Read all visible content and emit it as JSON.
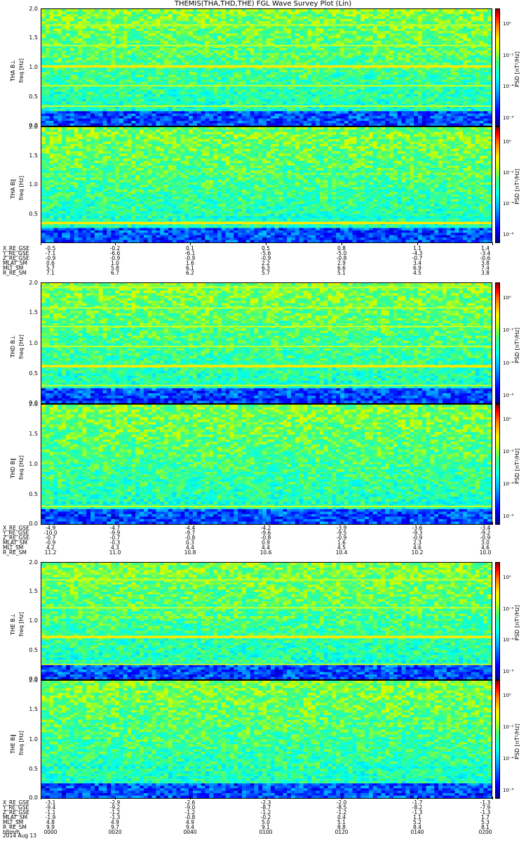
{
  "title": "THEMIS(THA,THD,THE) FGL Wave Survey Plot (Lin)",
  "colorbar": {
    "label": "PSD [nT²/Hz]",
    "ticks": [
      "10⁰",
      "10⁻²",
      "10⁻⁴",
      "10⁻⁶"
    ]
  },
  "chart_data": [
    {
      "type": "heatmap",
      "probe": "THA",
      "component": "B⊥",
      "ylabel_top": "THA B⊥",
      "ylabel_bottom": "freq [Hz]",
      "ylim": [
        0,
        2.0
      ],
      "yticks": [
        "0.0",
        "0.5",
        "1.0",
        "1.5",
        "2.0"
      ],
      "tones_hz": [
        0.33,
        0.68,
        1.02,
        1.37,
        1.72
      ],
      "strong_tones_hz": [
        1.02
      ],
      "colorbar_ticks": [
        "10⁰",
        "10⁻²",
        "10⁻⁴",
        "10⁻⁶"
      ]
    },
    {
      "type": "heatmap",
      "probe": "THA",
      "component": "B∥",
      "ylabel_top": "THA B∥",
      "ylabel_bottom": "freq [Hz]",
      "ylim": [
        0,
        2.0
      ],
      "yticks": [
        "0.5",
        "1.0",
        "1.5",
        "2.0"
      ],
      "tones_hz": [
        0.34
      ],
      "strong_tones_hz": [
        0.34
      ],
      "colorbar_ticks": [
        "10⁰",
        "10⁻²",
        "10⁻⁴",
        "10⁻⁶"
      ]
    },
    {
      "type": "heatmap",
      "probe": "THD",
      "component": "B⊥",
      "ylabel_top": "THD B⊥",
      "ylabel_bottom": "freq [Hz]",
      "ylim": [
        0,
        2.0
      ],
      "yticks": [
        "0.0",
        "0.5",
        "1.0",
        "1.5",
        "2.0"
      ],
      "tones_hz": [
        0.29,
        0.62,
        0.94,
        1.27,
        1.58,
        1.92
      ],
      "strong_tones_hz": [
        0.62
      ],
      "colorbar_ticks": [
        "10⁰",
        "10⁻²",
        "10⁻⁴",
        "10⁻⁶"
      ]
    },
    {
      "type": "heatmap",
      "probe": "THD",
      "component": "B∥",
      "ylabel_top": "THD B∥",
      "ylabel_bottom": "freq [Hz]",
      "ylim": [
        0,
        2.0
      ],
      "yticks": [
        "0.0",
        "0.5",
        "1.0",
        "1.5",
        "2.0"
      ],
      "tones_hz": [
        0.29
      ],
      "strong_tones_hz": [],
      "colorbar_ticks": [
        "10⁰",
        "10⁻²",
        "10⁻⁴",
        "10⁻⁶"
      ]
    },
    {
      "type": "heatmap",
      "probe": "THE",
      "component": "B⊥",
      "ylabel_top": "THE B⊥",
      "ylabel_bottom": "freq [Hz]",
      "ylim": [
        0,
        2.0
      ],
      "yticks": [
        "0.0",
        "0.5",
        "1.0",
        "1.5",
        "2.0"
      ],
      "tones_hz": [
        0.25,
        0.73,
        1.22,
        1.7
      ],
      "strong_tones_hz": [
        0.73
      ],
      "colorbar_ticks": [
        "10⁰",
        "10⁻²",
        "10⁻⁴",
        "10⁻⁶"
      ]
    },
    {
      "type": "heatmap",
      "probe": "THE",
      "component": "B∥",
      "ylabel_top": "THE B∥",
      "ylabel_bottom": "freq [Hz]",
      "ylim": [
        0,
        2.0
      ],
      "yticks": [
        "0.0",
        "0.5",
        "1.0",
        "1.5",
        "2.0"
      ],
      "tones_hz": [],
      "strong_tones_hz": [],
      "colorbar_ticks": [
        "10⁰",
        "10⁻²",
        "10⁻⁴",
        "10⁻⁶"
      ]
    }
  ],
  "ephemeris": [
    {
      "rows": [
        {
          "name": "X_RE_GSE",
          "values": [
            "-0.5",
            "-0.2",
            "0.1",
            "0.5",
            "0.8",
            "1.1",
            "1.4"
          ]
        },
        {
          "name": "Y_RE_GSE",
          "values": [
            "-7.1",
            "-6.6",
            "-6.1",
            "-5.6",
            "-5.0",
            "-4.3",
            "-3.4"
          ]
        },
        {
          "name": "Z_RE_GSE",
          "values": [
            "-0.9",
            "-0.9",
            "-0.9",
            "-0.9",
            "-0.8",
            "-0.7",
            "-0.6"
          ]
        },
        {
          "name": "MLAT_SM",
          "values": [
            "0.6",
            "1.0",
            "1.6",
            "2.2",
            "2.9",
            "3.4",
            "3.8"
          ]
        },
        {
          "name": "MLT_SM",
          "values": [
            "5.7",
            "5.8",
            "6.1",
            "6.3",
            "6.6",
            "6.9",
            "7.4"
          ]
        },
        {
          "name": "R_RE_SM",
          "values": [
            "7.1",
            "6.7",
            "6.2",
            "5.7",
            "5.1",
            "4.5",
            "3.8"
          ]
        }
      ]
    },
    {
      "rows": [
        {
          "name": "X_RE_GSE",
          "values": [
            "-4.9",
            "-4.7",
            "-4.4",
            "-4.2",
            "-3.9",
            "-3.6",
            "-3.4"
          ]
        },
        {
          "name": "Y_RE_GSE",
          "values": [
            "-10.0",
            "-9.9",
            "-9.7",
            "-9.6",
            "-9.5",
            "-9.3",
            "-9.2"
          ]
        },
        {
          "name": "Z_RE_GSE",
          "values": [
            "-0.7",
            "-0.7",
            "-0.8",
            "-0.8",
            "-0.9",
            "-0.9",
            "-0.9"
          ]
        },
        {
          "name": "MLAT_SM",
          "values": [
            "-0.9",
            "-0.3",
            "0.3",
            "0.9",
            "1.6",
            "2.3",
            "3.0"
          ]
        },
        {
          "name": "MLT_SM",
          "values": [
            "4.2",
            "4.3",
            "4.4",
            "4.4",
            "4.5",
            "4.6",
            "4.6"
          ]
        },
        {
          "name": "R_RE_SM",
          "values": [
            "11.2",
            "11.0",
            "10.8",
            "10.6",
            "10.4",
            "10.2",
            "10.0"
          ]
        }
      ]
    },
    {
      "rows": [
        {
          "name": "X_RE_GSE",
          "values": [
            "-3.1",
            "-2.9",
            "-2.6",
            "-2.3",
            "-2.0",
            "-1.7",
            "-1.3"
          ]
        },
        {
          "name": "Y_RE_GSE",
          "values": [
            "-9.4",
            "-9.2",
            "-9.0",
            "-8.7",
            "-8.5",
            "-8.2",
            "-7.9"
          ]
        },
        {
          "name": "Z_RE_GSE",
          "values": [
            "-1.1",
            "-1.2",
            "-1.2",
            "-1.2",
            "-1.2",
            "-1.3",
            "-1.3"
          ]
        },
        {
          "name": "MLAT_SM",
          "values": [
            "-1.9",
            "-1.3",
            "-0.8",
            "-0.2",
            "0.4",
            "1.1",
            "1.7"
          ]
        },
        {
          "name": "MLT_SM",
          "values": [
            "4.8",
            "4.9",
            "4.9",
            "5.0",
            "5.1",
            "5.2",
            "5.3"
          ]
        },
        {
          "name": "R_RE_SM",
          "values": [
            "9.9",
            "9.7",
            "9.4",
            "9.1",
            "8.8",
            "8.4",
            "8.1"
          ]
        },
        {
          "name": "hhmm",
          "values": [
            "0000",
            "0020",
            "0040",
            "0100",
            "0120",
            "0140",
            "0200"
          ]
        }
      ]
    }
  ],
  "date": "2014 Aug 13"
}
